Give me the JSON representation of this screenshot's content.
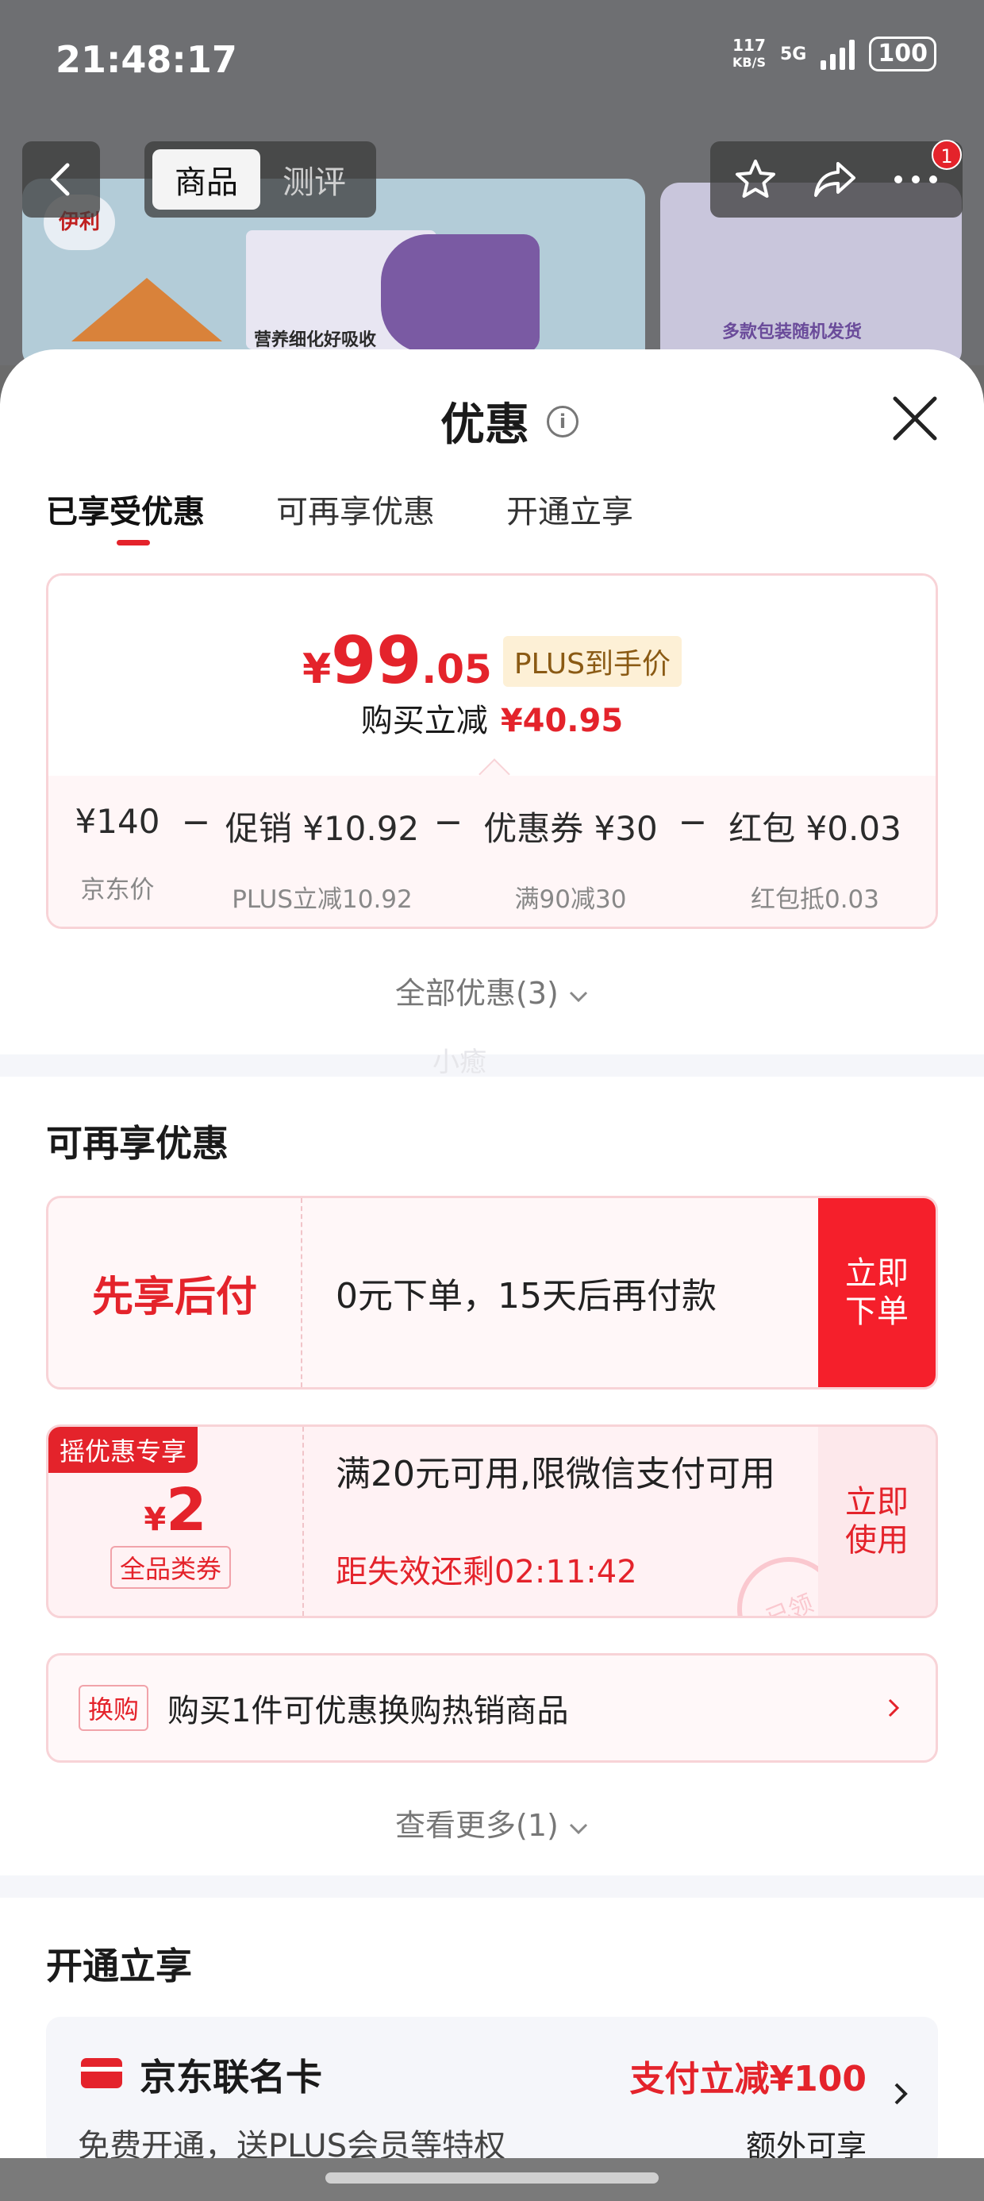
{
  "status_bar": {
    "time": "21:48:17",
    "net_speed": "117",
    "net_unit": "KB/S",
    "network": "5G",
    "battery": "100"
  },
  "product_header": {
    "back_icon": "chevron-left-icon",
    "tabs": [
      {
        "label": "商品",
        "active": true
      },
      {
        "label": "测评",
        "active": false
      }
    ],
    "actions": [
      "star-icon",
      "share-icon",
      "more-icon"
    ],
    "badge_count": "1",
    "brand_logo_text": "伊利",
    "image_caption": "营养细化好吸收",
    "side_image_caption": "多款包装随机发货"
  },
  "sheet": {
    "title": "优惠",
    "info_icon": "i",
    "close_icon": "close-icon",
    "tabs": [
      {
        "label": "已享受优惠",
        "active": true
      },
      {
        "label": "可再享优惠",
        "active": false
      },
      {
        "label": "开通立享",
        "active": false
      }
    ]
  },
  "summary": {
    "price_yen": "¥",
    "price_int": "99",
    "price_dec": ".05",
    "price_tag": "PLUS到手价",
    "reduce_label": "购买立减",
    "reduce_amount": "¥40.95",
    "calc": [
      {
        "value": "¥140",
        "sub": "京东价"
      },
      {
        "value": "促销 ¥10.92",
        "sub": "PLUS立减10.92"
      },
      {
        "value": "优惠券 ¥30",
        "sub": "满90减30"
      },
      {
        "value": "红包 ¥0.03",
        "sub": "红包抵0.03"
      }
    ],
    "operator": "−",
    "all_offers": "全部优惠(3)"
  },
  "watermark": "小癒",
  "more_offers": {
    "title": "可再享优惠",
    "bnpl": {
      "name": "先享后付",
      "desc": "0元下单，15天后再付款",
      "button_line1": "立即",
      "button_line2": "下单"
    },
    "coupon": {
      "tag": "摇优惠专享",
      "currency": "¥",
      "amount": "2",
      "type": "全品类券",
      "desc": "满20元可用,限微信支付可用",
      "timer": "距失效还剩02:11:42",
      "button_line1": "立即",
      "button_line2": "使用",
      "stamp": "已领"
    },
    "swap": {
      "tag": "换购",
      "text": "购买1件可优惠换购热销商品",
      "arrow_icon": "chevron-right-icon"
    },
    "see_more": "查看更多(1)"
  },
  "open_now": {
    "title": "开通立享",
    "card": {
      "name": "京东联名卡",
      "sub": "免费开通，送PLUS会员等特权",
      "promo": "支付立减¥100",
      "extra": "额外可享",
      "icon": "card-icon",
      "chevron_icon": "chevron-right-icon"
    }
  },
  "colors": {
    "accent": "#e4232b",
    "plus_bg": "#fdf0d6",
    "card_border": "#f8d3d7"
  }
}
